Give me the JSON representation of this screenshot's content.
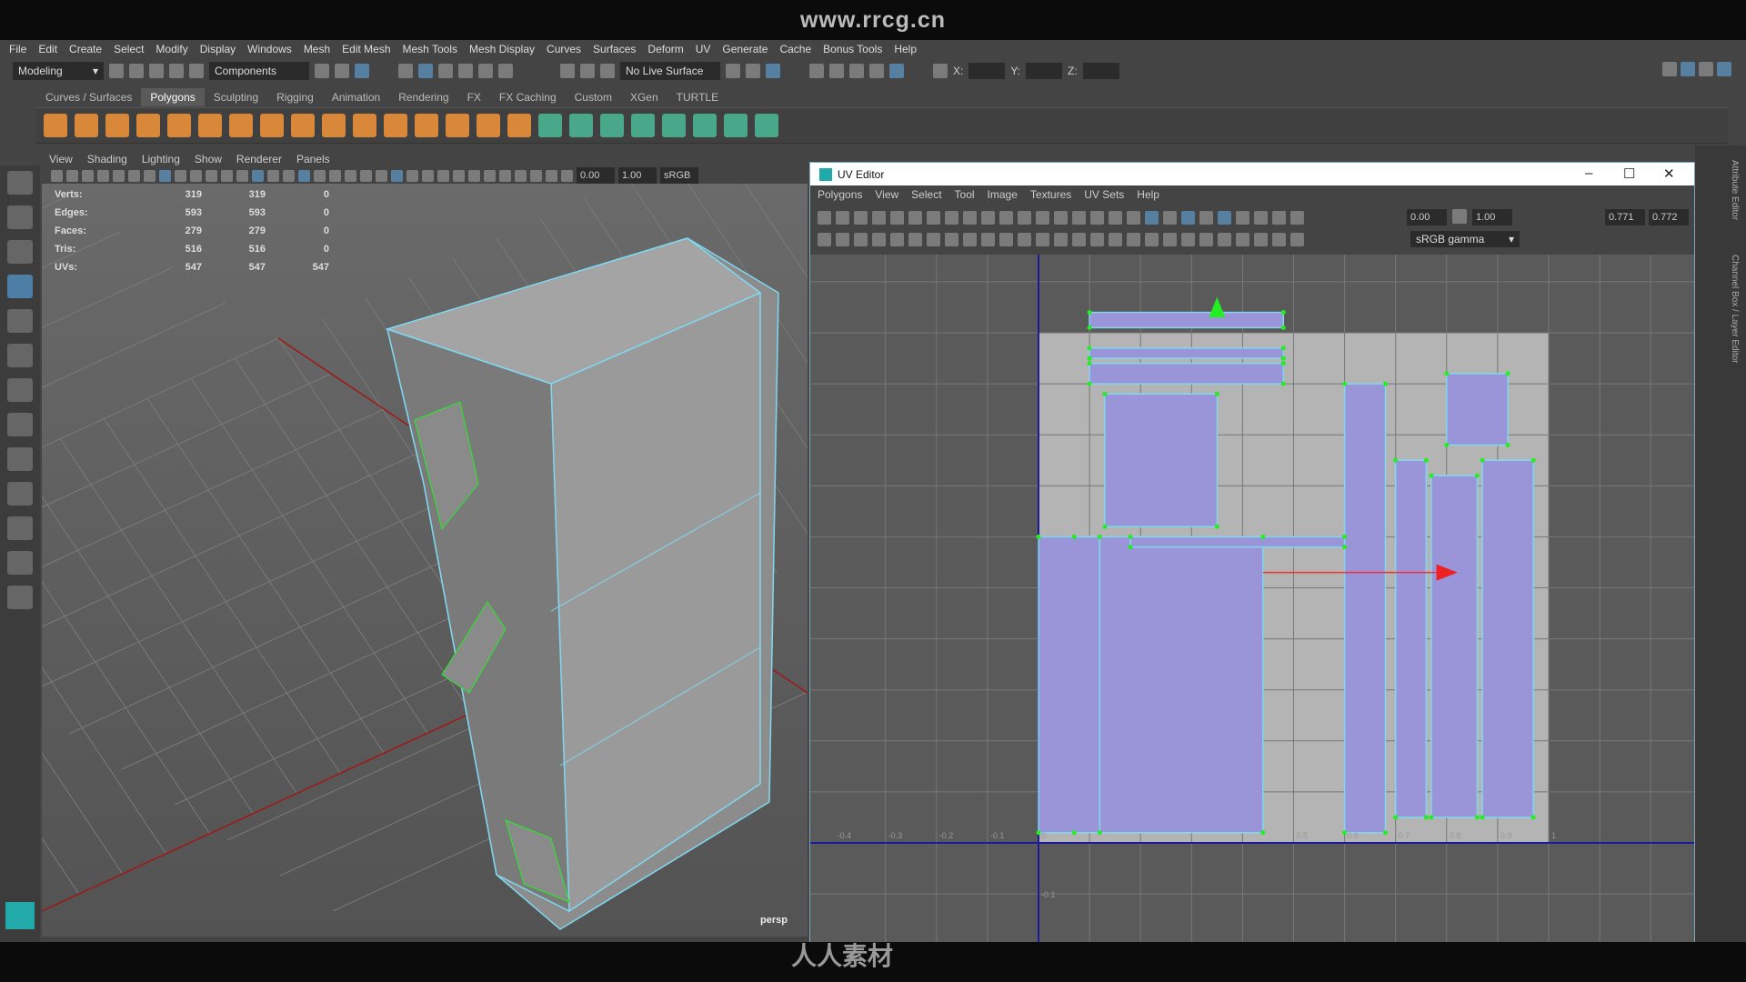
{
  "watermark": "www.rrcg.cn",
  "menubar": [
    "File",
    "Edit",
    "Create",
    "Select",
    "Modify",
    "Display",
    "Windows",
    "Mesh",
    "Edit Mesh",
    "Mesh Tools",
    "Mesh Display",
    "Curves",
    "Surfaces",
    "Deform",
    "UV",
    "Generate",
    "Cache",
    "Bonus Tools",
    "Help"
  ],
  "status": {
    "mode": "Modeling",
    "selection_mode": "Components",
    "live_surface": "No Live Surface",
    "x_label": "X:",
    "y_label": "Y:",
    "z_label": "Z:"
  },
  "shelf": {
    "tabs": [
      "Curves / Surfaces",
      "Polygons",
      "Sculpting",
      "Rigging",
      "Animation",
      "Rendering",
      "FX",
      "FX Caching",
      "Custom",
      "XGen",
      "TURTLE"
    ],
    "active": "Polygons"
  },
  "viewport": {
    "menu": [
      "View",
      "Shading",
      "Lighting",
      "Show",
      "Renderer",
      "Panels"
    ],
    "exposure": "0.00",
    "gamma": "1.00",
    "color_space": "sRGB gamma",
    "camera": "persp",
    "stats": [
      {
        "label": "Verts:",
        "a": "319",
        "b": "319",
        "c": "0"
      },
      {
        "label": "Edges:",
        "a": "593",
        "b": "593",
        "c": "0"
      },
      {
        "label": "Faces:",
        "a": "279",
        "b": "279",
        "c": "0"
      },
      {
        "label": "Tris:",
        "a": "516",
        "b": "516",
        "c": "0"
      },
      {
        "label": "UVs:",
        "a": "547",
        "b": "547",
        "c": "547"
      }
    ]
  },
  "uv_editor": {
    "title": "UV Editor",
    "menu": [
      "Polygons",
      "View",
      "Select",
      "Tool",
      "Image",
      "Textures",
      "UV Sets",
      "Help"
    ],
    "exposure": "0.00",
    "gamma": "1.00",
    "color_space": "sRGB gamma",
    "u_value": "0.771",
    "v_value": "0.772",
    "axis_labels_u": [
      "-0.4",
      "-0.3",
      "-0.2",
      "-0.1",
      "0",
      "0.5",
      "0.6",
      "0.7",
      "0.8",
      "0.9",
      "1"
    ],
    "axis_labels_v": [
      "-0.1"
    ],
    "colors": {
      "uv_shell": "#9a94d8",
      "uv_edge": "#7fd8f0",
      "uv_vertex": "#22ee22",
      "tile_bg": "#b4b4b4"
    }
  },
  "right_panel": {
    "attribute_editor": "Attribute Editor",
    "channel_box": "Channel Box / Layer Editor"
  },
  "bottom_logo": "人人素材"
}
